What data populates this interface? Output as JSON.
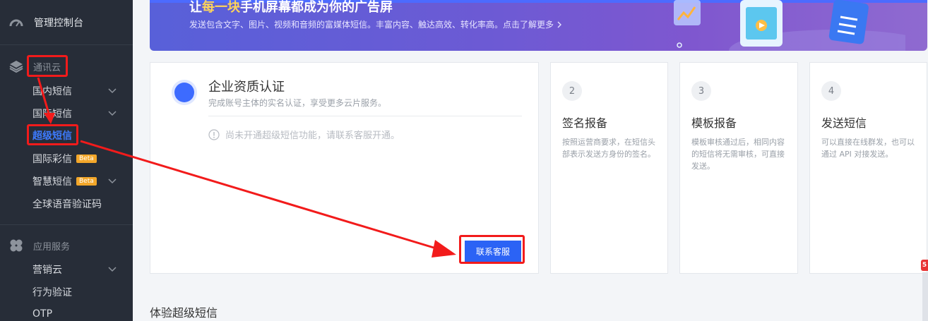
{
  "sidebar": {
    "dashboard": "管理控制台",
    "group_comm": "通讯云",
    "comm_items": [
      {
        "label": "国内短信",
        "expandable": true
      },
      {
        "label": "国际短信",
        "expandable": true
      },
      {
        "label": "超级短信",
        "active": true
      },
      {
        "label": "国际彩信",
        "badge": "Beta"
      },
      {
        "label": "智慧短信",
        "badge": "Beta",
        "expandable": true
      },
      {
        "label": "全球语音验证码"
      }
    ],
    "group_app": "应用服务",
    "app_items": [
      {
        "label": "营销云",
        "expandable": true
      },
      {
        "label": "行为验证"
      },
      {
        "label": "OTP"
      }
    ]
  },
  "banner": {
    "title_pre": "让",
    "title_highlight": "每一块",
    "title_post": "手机屏幕都成为你的广告屏",
    "subtitle": "发送包含文字、图片、视频和音频的富媒体短信。丰富内容、触达高效、转化率高。点击了解更多"
  },
  "step1": {
    "title": "企业资质认证",
    "subtitle": "完成账号主体的实名认证，享受更多云片服务。",
    "notice": "尚未开通超级短信功能，请联系客服开通。",
    "button": "联系客服"
  },
  "steps": [
    {
      "num": "2",
      "title": "签名报备",
      "desc": "按照运营商要求，在短信头部表示发送方身份的签名。"
    },
    {
      "num": "3",
      "title": "模板报备",
      "desc": "模板审核通过后，相同内容的短信将无需审核，可直接发送。"
    },
    {
      "num": "4",
      "title": "发送短信",
      "desc": "可以直接在线群发，也可以通过 API 对接发送。"
    }
  ],
  "section_title": "体验超级短信",
  "edge_badge": "5",
  "colors": {
    "accent": "#2b63f5",
    "annotation": "#f21b1b",
    "sidebar_bg": "#272d38",
    "highlight": "#ffd55a"
  }
}
